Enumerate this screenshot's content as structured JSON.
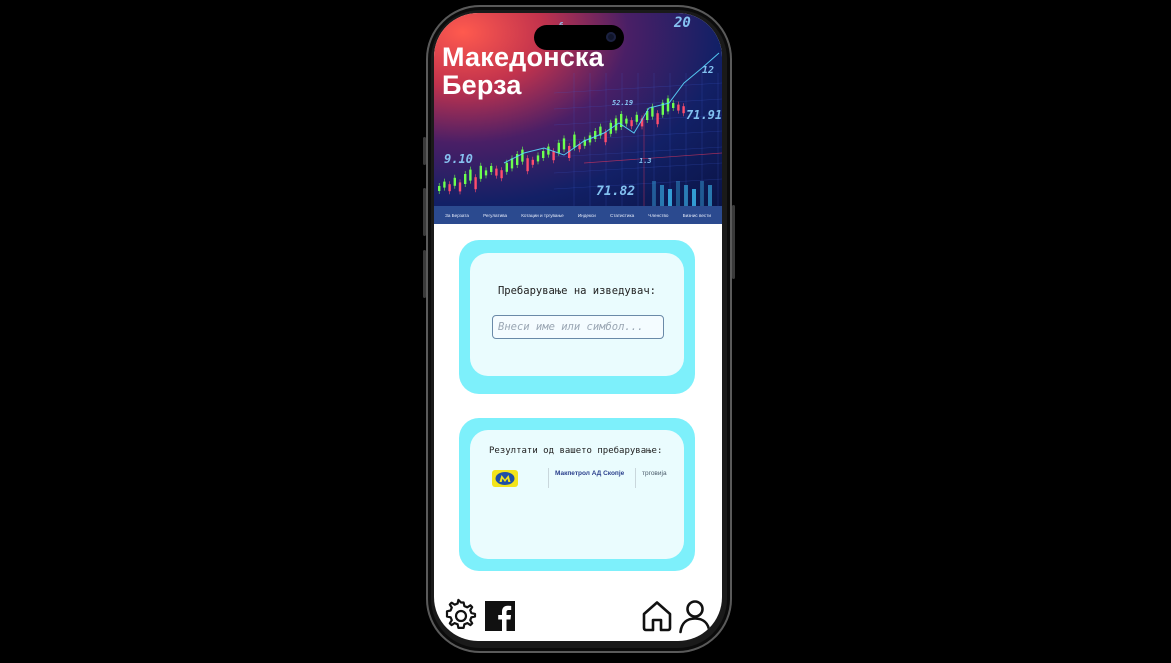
{
  "hero": {
    "title_line1": "Македонска",
    "title_line2": "Берза",
    "ticker_labels": [
      "20",
      "12",
      "71.91",
      "52.19",
      "9.10",
      "71.82",
      "6.",
      "1.3"
    ]
  },
  "nav": {
    "items": [
      "За Берзата",
      "Регулатива",
      "Котации и тргување",
      "Индекси",
      "Статистика",
      "Членство",
      "Бизнис вести"
    ]
  },
  "search": {
    "label": "Пребарување на изведувач:",
    "input_value": "",
    "placeholder": "Внеси име или симбол..."
  },
  "results": {
    "label": "Резултати од вашето пребарување:",
    "rows": [
      {
        "logo": "makpetrol-logo",
        "name": "Макпетрол АД Скопје",
        "sector": "трговија"
      }
    ]
  },
  "bottom_bar": {
    "icons": [
      "gear-icon",
      "facebook-icon",
      "home-icon",
      "user-icon"
    ]
  },
  "colors": {
    "card_outer": "#7df0fb",
    "card_inner": "#eafcfe",
    "nav_bg": "#2b4a8f",
    "logo_yellow": "#f3e41b",
    "logo_blue": "#1f4fa5"
  }
}
